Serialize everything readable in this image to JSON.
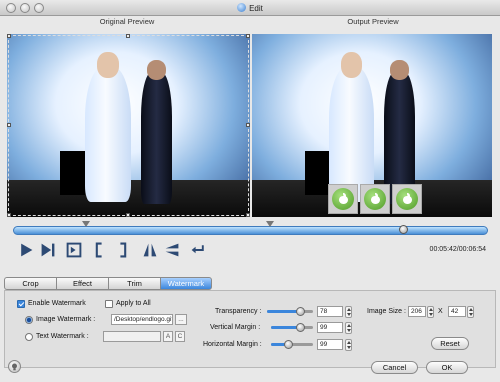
{
  "window": {
    "title": "Edit"
  },
  "preview": {
    "original_label": "Original Preview",
    "output_label": "Output Preview"
  },
  "playback": {
    "time": "00:05:42/00:06:54",
    "buttons": [
      "play-icon",
      "next-frame-icon",
      "snapshot-icon",
      "set-start-icon",
      "set-end-icon",
      "flip-horizontal-icon",
      "flip-vertical-icon",
      "rotate-icon"
    ]
  },
  "tabs": [
    {
      "label": "Crop",
      "active": false
    },
    {
      "label": "Effect",
      "active": false
    },
    {
      "label": "Trim",
      "active": false
    },
    {
      "label": "Watermark",
      "active": true
    }
  ],
  "watermark": {
    "enable_label": "Enable Watermark",
    "enable_checked": true,
    "apply_all_label": "Apply to All",
    "apply_all_checked": false,
    "image_label": "Image Watermark :",
    "image_selected": true,
    "image_path": "/Desktop/endlogo.gif",
    "browse_label": "...",
    "text_label": "Text Watermark :",
    "text_selected": false,
    "text_value": "",
    "text_btn_a": "A",
    "text_btn_c": "C"
  },
  "adjust": {
    "transparency_label": "Transparency :",
    "transparency_value": "78",
    "transparency_level": 0.78,
    "vmargin_label": "Vertical Margin :",
    "vmargin_value": "99",
    "vmargin_level": 0.75,
    "hmargin_label": "Horizontal Margin :",
    "hmargin_value": "99",
    "hmargin_level": 0.4
  },
  "image_size": {
    "label": "Image Size :",
    "width": "206",
    "x_label": "X",
    "height": "42",
    "reset_label": "Reset"
  },
  "footer": {
    "cancel_label": "Cancel",
    "ok_label": "OK"
  },
  "colors": {
    "accent": "#3b86dc",
    "watermark_green": "#5fae2e"
  }
}
